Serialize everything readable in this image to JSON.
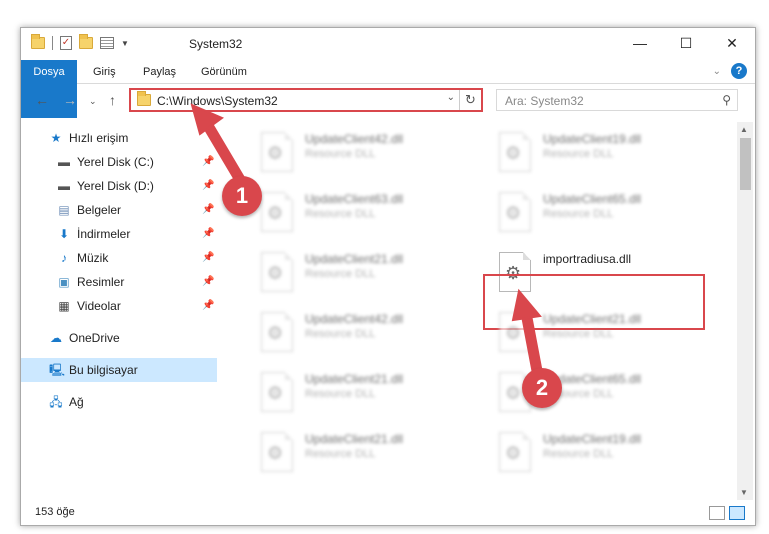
{
  "window": {
    "title": "System32",
    "controls": [
      "—",
      "☐",
      "✕"
    ]
  },
  "ribbon": {
    "tabs": [
      "Dosya",
      "Giriş",
      "Paylaş",
      "Görünüm"
    ],
    "help": "?"
  },
  "address": {
    "path": "C:\\Windows\\System32",
    "refresh": "↻"
  },
  "search": {
    "placeholder": "Ara: System32"
  },
  "nav": {
    "items": [
      {
        "label": "Hızlı erişim",
        "icon": "star-icon"
      },
      {
        "label": "Yerel Disk (C:)",
        "icon": "drive-icon"
      },
      {
        "label": "Yerel Disk (D:)",
        "icon": "drive-icon"
      },
      {
        "label": "Belgeler",
        "icon": "documents-icon"
      },
      {
        "label": "İndirmeler",
        "icon": "download-icon"
      },
      {
        "label": "Müzik",
        "icon": "music-icon"
      },
      {
        "label": "Resimler",
        "icon": "pictures-icon"
      },
      {
        "label": "Videolar",
        "icon": "video-icon"
      },
      {
        "label": "OneDrive",
        "icon": "cloud-icon"
      },
      {
        "label": "Bu bilgisayar",
        "icon": "computer-icon"
      },
      {
        "label": "Ağ",
        "icon": "network-icon"
      }
    ]
  },
  "files": [
    {
      "name": "UpdateClient42.dll",
      "type": "Resource DLL"
    },
    {
      "name": "UpdateClient19.dll",
      "type": "Resource DLL"
    },
    {
      "name": "UpdateClient63.dll",
      "type": "Resource DLL"
    },
    {
      "name": "UpdateClient65.dll",
      "type": "Resource DLL"
    },
    {
      "name": "UpdateClient21.dll",
      "type": "Resource DLL"
    },
    {
      "name": "importradiusa.dll",
      "type": ""
    },
    {
      "name": "UpdateClient42.dll",
      "type": "Resource DLL"
    },
    {
      "name": "UpdateClient21.dll",
      "type": "Resource DLL"
    },
    {
      "name": "UpdateClient21.dll",
      "type": "Resource DLL"
    },
    {
      "name": "UpdateClient65.dll",
      "type": "Resource DLL"
    },
    {
      "name": "UpdateClient21.dll",
      "type": "Resource DLL"
    },
    {
      "name": "UpdateClient19.dll",
      "type": "Resource DLL"
    }
  ],
  "status": {
    "count": "153 öğe"
  },
  "annotations": {
    "step1": "1",
    "step2": "2",
    "color": "#d9474c"
  }
}
